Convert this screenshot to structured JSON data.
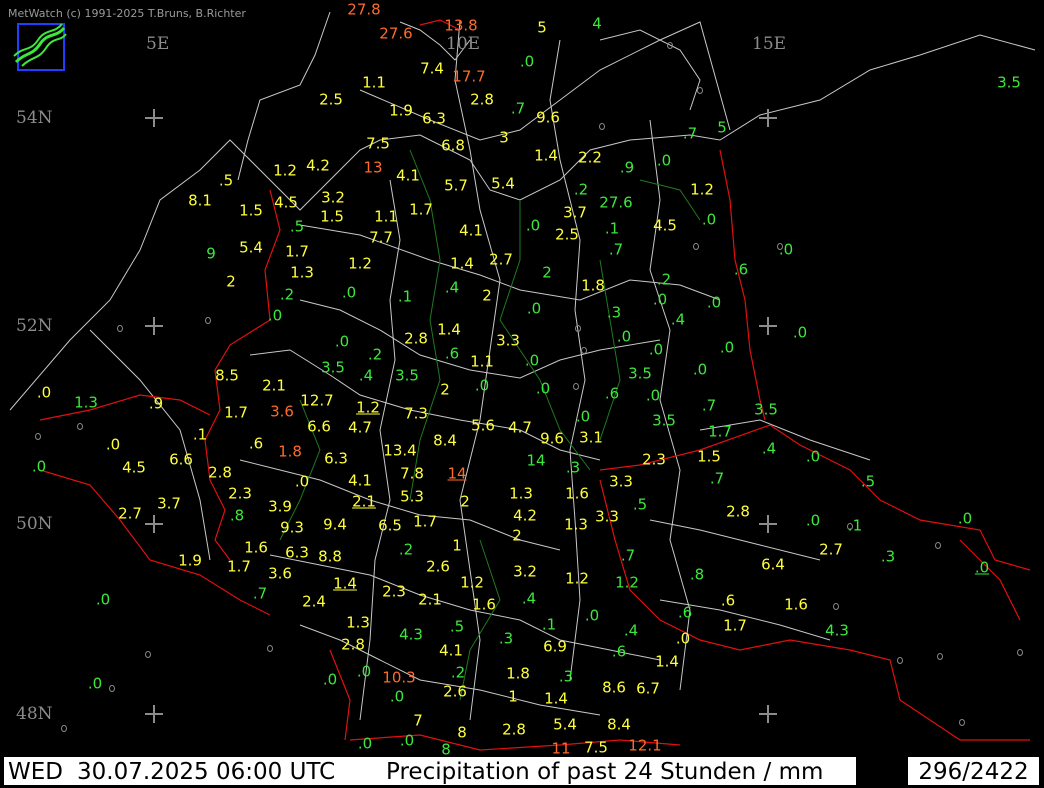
{
  "header": {
    "copyright": "MetWatch  (c) 1991-2025 T.Bruns, B.Richter"
  },
  "grid": {
    "meridians": [
      "5E",
      "10E",
      "15E"
    ],
    "parallels": [
      "54N",
      "52N",
      "50N",
      "48N"
    ]
  },
  "colors": {
    "background": "#000000",
    "value_low": "#3ce83c",
    "value_mid": "#ffff3a",
    "value_high": "#ff6a2a",
    "border": "#e01010",
    "contour": "#c8c8c8",
    "rivers": "#1f7a1f",
    "grid": "#8c8c8c"
  },
  "icons": [
    "metwatch-logo-icon",
    "grid-cross-icon",
    "station-marker-icon"
  ],
  "values": [
    "27.8",
    "27.6",
    "13.8",
    "5",
    "4",
    "10E",
    "7.4",
    "17.7",
    ".0",
    "1.1",
    "2.5",
    "1.9",
    "6.3",
    "2.8",
    ".7",
    "9.6",
    "7.5",
    "6.8",
    "3",
    "1.4",
    "2.2",
    "1.2",
    "4.2",
    "13",
    "4.1",
    ".9",
    "5.7",
    "5.4",
    ".5",
    "8.1",
    "3.2",
    "4.5",
    ".2",
    "1.5",
    "1.1",
    "1.7",
    "3.7",
    "5.4",
    "7.7",
    "4.1",
    ".0",
    "2.5",
    ".1",
    "4.5",
    "9",
    "2",
    "1.3",
    "1.2",
    "1.4",
    "2.7",
    "2",
    ".6",
    "1.8",
    ".2",
    ".0",
    ".4",
    "2",
    ".0",
    ".3",
    ".0",
    "2.8",
    "1.4",
    "3.3",
    ".0",
    ".6",
    "1.1",
    ".0",
    "8.5",
    "2.1",
    ".4",
    "2",
    ".0",
    ".0",
    ".6",
    ".1",
    ".0",
    "1.3",
    ".9",
    "1.7",
    "3.6",
    "12.7",
    "1.2",
    "7.3",
    "3.5",
    ".7",
    ".1",
    "6.6",
    "4.7",
    "5.6",
    "4.7",
    "9.6",
    "3.1",
    "1.7",
    ".6",
    "1.8",
    "13.4",
    "8.4",
    "2.3",
    "1.5",
    "1.4",
    ".4",
    ".0",
    "4.5",
    "6.6",
    "2.8",
    "6.3",
    "4.1",
    "7.8",
    "14",
    ".3",
    ".7",
    ".5",
    ".0",
    "2.3",
    "3",
    "3.9",
    "2.1",
    "5.3",
    "1.3",
    "1.6",
    "3.3",
    "2.7",
    "3.7",
    ".8",
    "9.3",
    "9.4",
    "6.5",
    "1.7",
    "2",
    "4.2",
    "1.3",
    "3.3",
    "2.8",
    ".0",
    ".1",
    ".0",
    "1.6",
    "2",
    "1.9",
    "6.3",
    "8.8",
    ".2",
    "1",
    "2.7",
    ".3",
    "1.7",
    "3.6",
    "2.6",
    "3.2",
    ".7",
    "6.4",
    "1.2",
    ".8",
    "1.4",
    "2.3",
    "2.1",
    "1.2",
    ".6",
    "1.7",
    "1.6",
    "4.3",
    ".1",
    ".7",
    "2.4",
    "1.6",
    ".4",
    ".6",
    "1.3",
    ".5",
    ".1",
    ".0",
    ".4",
    "2.8",
    ".3",
    "4.1",
    "6.9",
    "1",
    "1.4",
    ".6",
    "1.8",
    ".3",
    ".0",
    "10.3",
    ".2",
    ".0",
    "2.6",
    "1.4",
    "8.6",
    "6.7",
    ".0",
    "7",
    "8",
    "2.8",
    "5.4",
    "8.4",
    ".0",
    ".0",
    "11",
    "7.5",
    "12.1"
  ],
  "footer": {
    "day": "WED",
    "datetime": "30.07.2025 06:00 UTC",
    "title": "Precipitation of past  24 Stunden  / mm",
    "count": "296/2422"
  }
}
